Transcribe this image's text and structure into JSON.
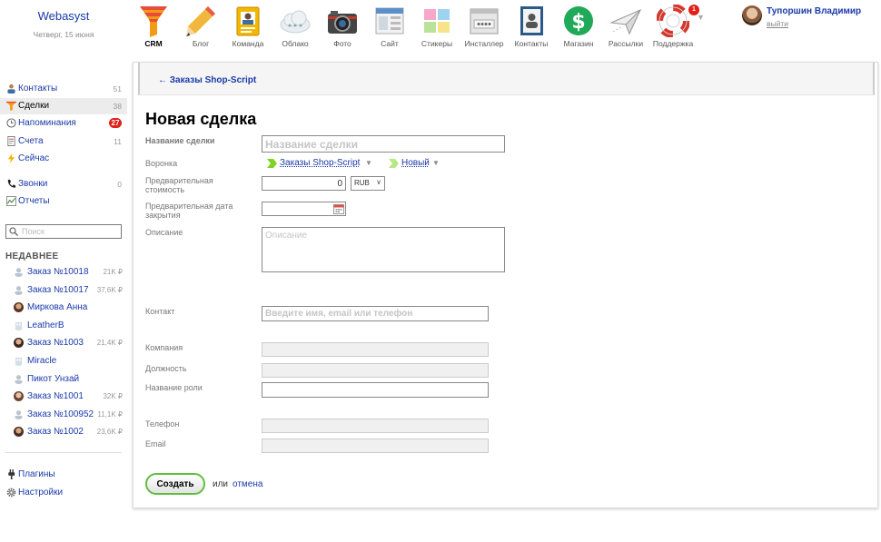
{
  "brand": {
    "name": "Webasyst",
    "date": "Четверг, 15 июня"
  },
  "apps": [
    {
      "label": "CRM",
      "icon": "crm-funnel-icon",
      "active": true
    },
    {
      "label": "Блог",
      "icon": "pencil-icon"
    },
    {
      "label": "Команда",
      "icon": "team-badge-icon"
    },
    {
      "label": "Облако",
      "icon": "cloud-icon"
    },
    {
      "label": "Фото",
      "icon": "camera-icon"
    },
    {
      "label": "Сайт",
      "icon": "site-window-icon"
    },
    {
      "label": "Стикеры",
      "icon": "stickers-icon"
    },
    {
      "label": "Инсталлер",
      "icon": "installer-box-icon"
    },
    {
      "label": "Контакты",
      "icon": "contacts-book-icon"
    },
    {
      "label": "Магазин",
      "icon": "dollar-shop-icon"
    },
    {
      "label": "Рассылки",
      "icon": "mail-plane-icon"
    },
    {
      "label": "Поддержка",
      "icon": "lifebuoy-icon",
      "badge": "1"
    }
  ],
  "apps_more": "▼",
  "user": {
    "name": "Тупоршин Владимир",
    "logout": "выйти"
  },
  "sidebar": {
    "items": [
      {
        "label": "Контакты",
        "count": "51",
        "icon": "contact-person-icon"
      },
      {
        "label": "Сделки",
        "count": "38",
        "icon": "deals-funnel-icon",
        "selected": true
      },
      {
        "label": "Напоминания",
        "badge": "27",
        "icon": "reminder-clock-icon"
      },
      {
        "label": "Счета",
        "count": "11",
        "icon": "invoice-icon"
      },
      {
        "label": "Сейчас",
        "icon": "lightning-icon"
      },
      {
        "label": "Звонки",
        "count": "0",
        "icon": "phone-icon"
      },
      {
        "label": "Отчеты",
        "icon": "reports-chart-icon"
      }
    ],
    "search_placeholder": "Поиск",
    "recent_title": "НЕДАВНЕЕ",
    "recent": [
      {
        "label": "Заказ №10018",
        "sum": "21K ₽",
        "icon": "user-silhouette-icon"
      },
      {
        "label": "Заказ №10017",
        "sum": "37,6K ₽",
        "icon": "user-silhouette-icon"
      },
      {
        "label": "Миркова Анна",
        "sum": "",
        "icon": "user-photo-icon"
      },
      {
        "label": "LeatherB",
        "sum": "",
        "icon": "company-icon"
      },
      {
        "label": "Заказ №1003",
        "sum": "21,4K ₽",
        "icon": "user-photo-icon"
      },
      {
        "label": "Miracle",
        "sum": "",
        "icon": "company-icon"
      },
      {
        "label": "Пикот Унзай",
        "sum": "",
        "icon": "user-silhouette-icon"
      },
      {
        "label": "Заказ №1001",
        "sum": "32K ₽",
        "icon": "user-photo-icon"
      },
      {
        "label": "Заказ №100952",
        "sum": "11,1K ₽",
        "icon": "user-silhouette-icon"
      },
      {
        "label": "Заказ №1002",
        "sum": "23,6K ₽",
        "icon": "user-photo-icon"
      }
    ],
    "bottom": [
      {
        "label": "Плагины",
        "icon": "plugin-plug-icon"
      },
      {
        "label": "Настройки",
        "icon": "settings-gear-icon"
      }
    ]
  },
  "main": {
    "back_link": "← Заказы Shop-Script",
    "title": "Новая сделка",
    "labels": {
      "name": "Название сделки",
      "funnel": "Воронка",
      "amount": "Предварительная стоимость",
      "close_date": "Предварительная дата закрытия",
      "description": "Описание",
      "contact": "Контакт",
      "company": "Компания",
      "position": "Должность",
      "role": "Название роли",
      "phone": "Телефон",
      "email": "Email"
    },
    "placeholders": {
      "name": "Название сделки",
      "description": "Описание",
      "contact": "Введите имя, email или телефон"
    },
    "funnel_value": "Заказы Shop-Script",
    "stage_value": "Новый",
    "amount_value": "0",
    "currency": "RUB",
    "create_label": "Создать",
    "or_text": "или",
    "cancel_label": "отмена"
  },
  "colors": {
    "link": "#1a3aa8",
    "accent_green": "#5fbf3d",
    "badge_red": "#e0201a",
    "funnel_green": "#7ed321"
  }
}
